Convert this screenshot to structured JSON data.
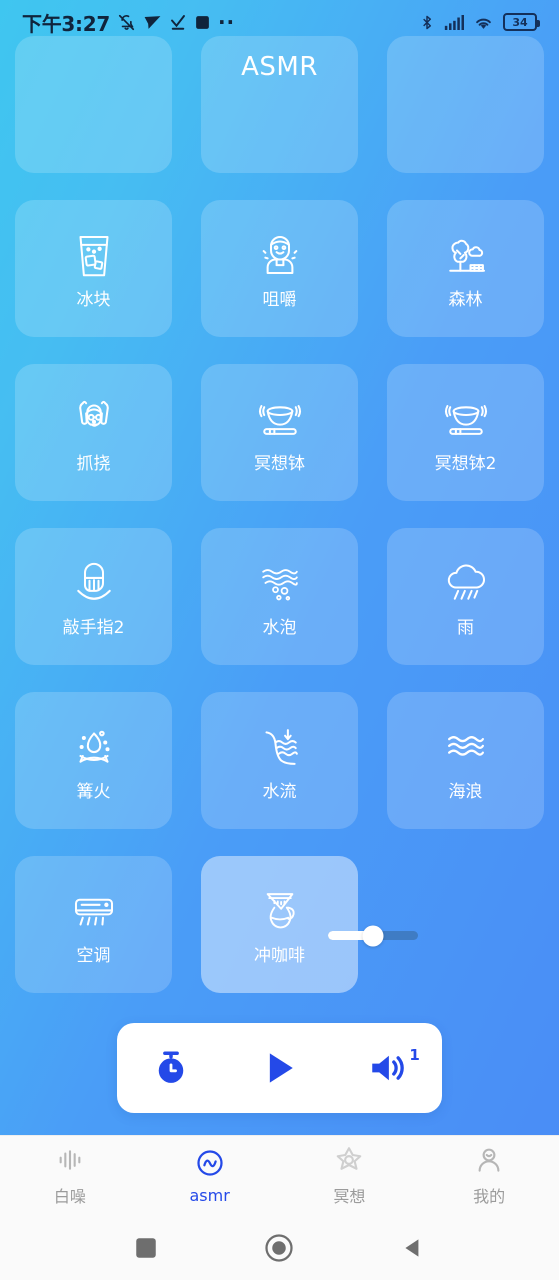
{
  "status_bar": {
    "time": "下午3:27",
    "battery_level": "34",
    "left_icons": [
      "bell-muted-icon",
      "send-arrow-icon",
      "download-check-icon",
      "square-icon",
      "more-dots-icon"
    ],
    "right_icons": [
      "bluetooth-icon",
      "cellular-signal-icon",
      "wifi-icon",
      "battery-icon"
    ]
  },
  "header": {
    "title": "ASMR"
  },
  "grid": {
    "partial_top_row": [
      {
        "label": "",
        "icon": "clipped-card"
      },
      {
        "label": "",
        "icon": "clipped-card"
      },
      {
        "label": "",
        "icon": "clipped-card"
      }
    ],
    "items": [
      {
        "label": "冰块",
        "icon": "ice-glass-icon",
        "active": false
      },
      {
        "label": "咀嚼",
        "icon": "chewing-person-icon",
        "active": false
      },
      {
        "label": "森林",
        "icon": "forest-tree-icon",
        "active": false
      },
      {
        "label": "抓挠",
        "icon": "scratching-head-icon",
        "active": false
      },
      {
        "label": "冥想钵",
        "icon": "singing-bowl-icon",
        "active": false
      },
      {
        "label": "冥想钵2",
        "icon": "singing-bowl-icon",
        "active": false
      },
      {
        "label": "敲手指2",
        "icon": "finger-tap-icon",
        "active": false
      },
      {
        "label": "水泡",
        "icon": "bubbles-icon",
        "active": false
      },
      {
        "label": "雨",
        "icon": "rain-cloud-icon",
        "active": false
      },
      {
        "label": "篝火",
        "icon": "campfire-icon",
        "active": false
      },
      {
        "label": "水流",
        "icon": "water-stream-icon",
        "active": false
      },
      {
        "label": "海浪",
        "icon": "ocean-waves-icon",
        "active": false
      },
      {
        "label": "空调",
        "icon": "air-conditioner-icon",
        "active": false
      },
      {
        "label": "冲咖啡",
        "icon": "pour-over-coffee-icon",
        "active": true
      }
    ]
  },
  "active_sound_slider": {
    "value_percent": 50,
    "track_color": "#3f7cc4",
    "fill_color": "#ffffff"
  },
  "player": {
    "accent_color": "#2449e8",
    "timer_icon": "timer-icon",
    "play_icon": "play-icon",
    "volume_icon": "volume-icon",
    "volume_badge": "1"
  },
  "bottom_nav": {
    "active_color": "#2449e8",
    "inactive_color": "#9b9b9b",
    "items": [
      {
        "label": "白噪",
        "icon": "waveform-icon",
        "active": false
      },
      {
        "label": "asmr",
        "icon": "asmr-wave-icon",
        "active": true
      },
      {
        "label": "冥想",
        "icon": "star-lotus-icon",
        "active": false
      },
      {
        "label": "我的",
        "icon": "user-profile-icon",
        "active": false
      }
    ]
  },
  "android_nav": {
    "items": [
      "recents-square-icon",
      "home-circle-icon",
      "back-triangle-icon"
    ]
  }
}
